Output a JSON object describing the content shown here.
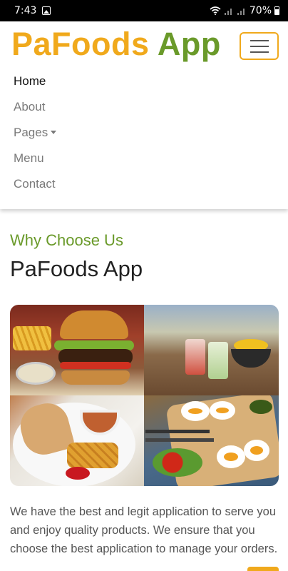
{
  "status_bar": {
    "time": "7:43",
    "battery": "70%"
  },
  "brand": {
    "part1": "PaFoods",
    "part2": "App",
    "part1_color": "#f0a91c",
    "part2_color": "#6a9a2a"
  },
  "nav": {
    "items": [
      {
        "label": "Home",
        "active": true
      },
      {
        "label": "About"
      },
      {
        "label": "Pages",
        "dropdown": true
      },
      {
        "label": "Menu"
      },
      {
        "label": "Contact"
      }
    ]
  },
  "section": {
    "subtitle": "Why Choose Us",
    "title": "PaFoods App",
    "body": "We have the best and legit application to serve you and enjoy quality products. We ensure that you choose the best application to manage your orders."
  },
  "colors": {
    "accent": "#f0a91c",
    "green": "#6a9a2a"
  }
}
